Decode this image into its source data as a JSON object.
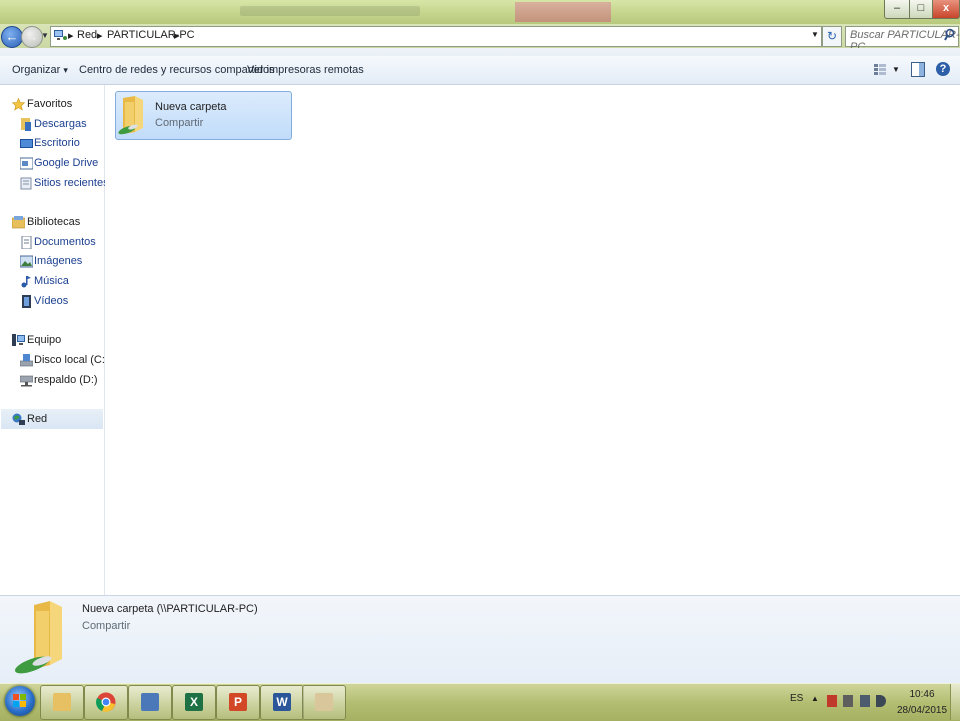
{
  "window": {
    "minimize_glyph": "–",
    "maximize_glyph": "□",
    "close_glyph": "x"
  },
  "address_bar": {
    "breadcrumbs": [
      "Red",
      "PARTICULAR-PC"
    ],
    "separator": "▸",
    "search_placeholder": "Buscar PARTICULAR-PC"
  },
  "toolbar": {
    "organize_label": "Organizar",
    "organize_arrow": "▾",
    "network_center_label": "Centro de redes y recursos compartidos",
    "remote_printers_label": "Ver impresoras remotas",
    "help_glyph": "?"
  },
  "nav_pane": {
    "favorites": {
      "label": "Favoritos",
      "items": [
        "Descargas",
        "Escritorio",
        "Google Drive",
        "Sitios recientes"
      ]
    },
    "libraries": {
      "label": "Bibliotecas",
      "items": [
        "Documentos",
        "Imágenes",
        "Música",
        "Vídeos"
      ]
    },
    "computer": {
      "label": "Equipo",
      "items": [
        "Disco local (C:)",
        "respaldo (D:)"
      ]
    },
    "network": {
      "label": "Red"
    }
  },
  "content": {
    "items": [
      {
        "name": "Nueva carpeta",
        "type": "Compartir"
      }
    ]
  },
  "details_pane": {
    "name": "Nueva carpeta (\\\\PARTICULAR-PC)",
    "type": "Compartir"
  },
  "taskbar": {
    "apps": [
      "explorer-icon",
      "chrome-icon",
      "network-computer-icon",
      "excel-icon",
      "powerpoint-icon",
      "word-icon",
      "paint-icon"
    ],
    "app_glyphs": {
      "excel": "X",
      "powerpoint": "P",
      "word": "W"
    },
    "language": "ES",
    "time": "10:46",
    "date": "28/04/2015"
  },
  "colors": {
    "selection": "#c1dcfa",
    "folder": "#f0c75a",
    "taskbar": "#b4be72"
  }
}
